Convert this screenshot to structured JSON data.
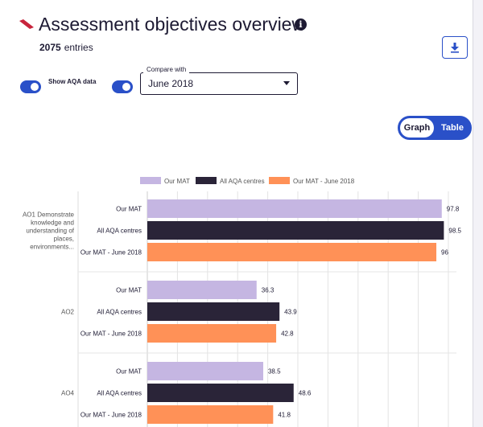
{
  "header": {
    "title": "Assessment objectives overview",
    "entries_count": "2075",
    "entries_label": "entries"
  },
  "controls": {
    "show_aqa_label": "Show AQA data",
    "show_aqa_on": true,
    "compare_toggle_on": true,
    "compare_label": "Compare with",
    "compare_value": "June 2018",
    "view_graph_label": "Graph",
    "view_table_label": "Table",
    "view_selected": "Graph"
  },
  "colors": {
    "accent": "#2a50c8",
    "logo": "#c8243c"
  },
  "icons": {
    "info": "info-icon",
    "download": "download-icon",
    "logo": "logo-icon"
  },
  "chart_data": {
    "type": "bar",
    "orientation": "horizontal",
    "legend_position": "top",
    "grid": true,
    "xlim": [
      0,
      100
    ],
    "series": [
      {
        "name": "Our MAT",
        "color": "#c5b6e2"
      },
      {
        "name": "All AQA centres",
        "color": "#2a2438"
      },
      {
        "name": "Our MAT - June 2018",
        "color": "#ff9157"
      }
    ],
    "groups": [
      {
        "category": "AO1 Demonstrate knowledge and understanding of places, environments...",
        "category_lines": [
          "AO1 Demonstrate",
          "knowledge and",
          "understanding of",
          "places,",
          "environments..."
        ],
        "bar_labels": [
          "Our MAT",
          "All AQA centres",
          "Our MAT - June 2018"
        ],
        "values": [
          97.8,
          98.5,
          96
        ],
        "value_labels": [
          "97.8",
          "98.5",
          "96"
        ]
      },
      {
        "category": "AO2",
        "category_lines": [
          "AO2"
        ],
        "bar_labels": [
          "Our MAT",
          "All AQA centres",
          "Our MAT - June 2018"
        ],
        "values": [
          36.3,
          43.9,
          42.8
        ],
        "value_labels": [
          "36.3",
          "43.9",
          "42.8"
        ]
      },
      {
        "category": "AO4",
        "category_lines": [
          "AO4"
        ],
        "bar_labels": [
          "Our MAT",
          "All AQA centres",
          "Our MAT - June 2018"
        ],
        "values": [
          38.5,
          48.6,
          41.8
        ],
        "value_labels": [
          "38.5",
          "48.6",
          "41.8"
        ]
      }
    ]
  }
}
